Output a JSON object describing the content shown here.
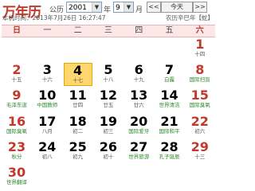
{
  "header": {
    "title": "万年历",
    "gongli_label": "公历",
    "year_value": "2001",
    "year_label": "年",
    "month_value": "9",
    "month_label": "月",
    "prev_label": "<<",
    "today_label": "今天",
    "next_label": ">>"
  },
  "subline": {
    "now": "本机时间：2013年7月26日 16:27:47",
    "lunar": "农历辛巳年【蛇】"
  },
  "weekdays": [
    "日",
    "一",
    "二",
    "三",
    "四",
    "五",
    "六"
  ],
  "weeks": [
    [
      {
        "num": "",
        "lunar": ""
      },
      {
        "num": "",
        "lunar": ""
      },
      {
        "num": "",
        "lunar": ""
      },
      {
        "num": "",
        "lunar": ""
      },
      {
        "num": "",
        "lunar": ""
      },
      {
        "num": "",
        "lunar": ""
      },
      {
        "num": "1",
        "lunar": "十四",
        "weekend": true
      }
    ],
    [
      {
        "num": "2",
        "lunar": "十五",
        "weekend": true
      },
      {
        "num": "3",
        "lunar": "十六"
      },
      {
        "num": "4",
        "lunar": "十七",
        "today": true
      },
      {
        "num": "5",
        "lunar": "十八"
      },
      {
        "num": "6",
        "lunar": "十九"
      },
      {
        "num": "7",
        "lunar": "白露",
        "green": true
      },
      {
        "num": "8",
        "lunar": "国际扫盲",
        "weekend": true,
        "green": true
      }
    ],
    [
      {
        "num": "9",
        "lunar": "毛泽东逝",
        "weekend": true,
        "green": true
      },
      {
        "num": "10",
        "lunar": "中国教师",
        "green": true
      },
      {
        "num": "11",
        "lunar": "廿四"
      },
      {
        "num": "12",
        "lunar": "廿五"
      },
      {
        "num": "13",
        "lunar": "廿六"
      },
      {
        "num": "14",
        "lunar": "世界清洁",
        "green": true
      },
      {
        "num": "15",
        "lunar": "国际臭氧",
        "weekend": true,
        "green": true
      }
    ],
    [
      {
        "num": "16",
        "lunar": "国际臭氧",
        "weekend": true,
        "green": true
      },
      {
        "num": "17",
        "lunar": "八月"
      },
      {
        "num": "18",
        "lunar": "初二"
      },
      {
        "num": "19",
        "lunar": "初三"
      },
      {
        "num": "20",
        "lunar": "国际爱牙",
        "green": true
      },
      {
        "num": "21",
        "lunar": "国际和平",
        "green": true
      },
      {
        "num": "22",
        "lunar": "初六",
        "weekend": true
      }
    ],
    [
      {
        "num": "23",
        "lunar": "秋分",
        "weekend": true,
        "green": true
      },
      {
        "num": "24",
        "lunar": "初八"
      },
      {
        "num": "25",
        "lunar": "初九"
      },
      {
        "num": "26",
        "lunar": "初十"
      },
      {
        "num": "27",
        "lunar": "世界旅游",
        "green": true
      },
      {
        "num": "28",
        "lunar": "孔子诞辰",
        "green": true
      },
      {
        "num": "29",
        "lunar": "十三",
        "weekend": true
      }
    ],
    [
      {
        "num": "30",
        "lunar": "世界翻译",
        "weekend": true,
        "green": true
      },
      {
        "num": "",
        "lunar": ""
      },
      {
        "num": "",
        "lunar": ""
      },
      {
        "num": "",
        "lunar": ""
      },
      {
        "num": "",
        "lunar": ""
      },
      {
        "num": "",
        "lunar": ""
      },
      {
        "num": "",
        "lunar": ""
      }
    ]
  ]
}
